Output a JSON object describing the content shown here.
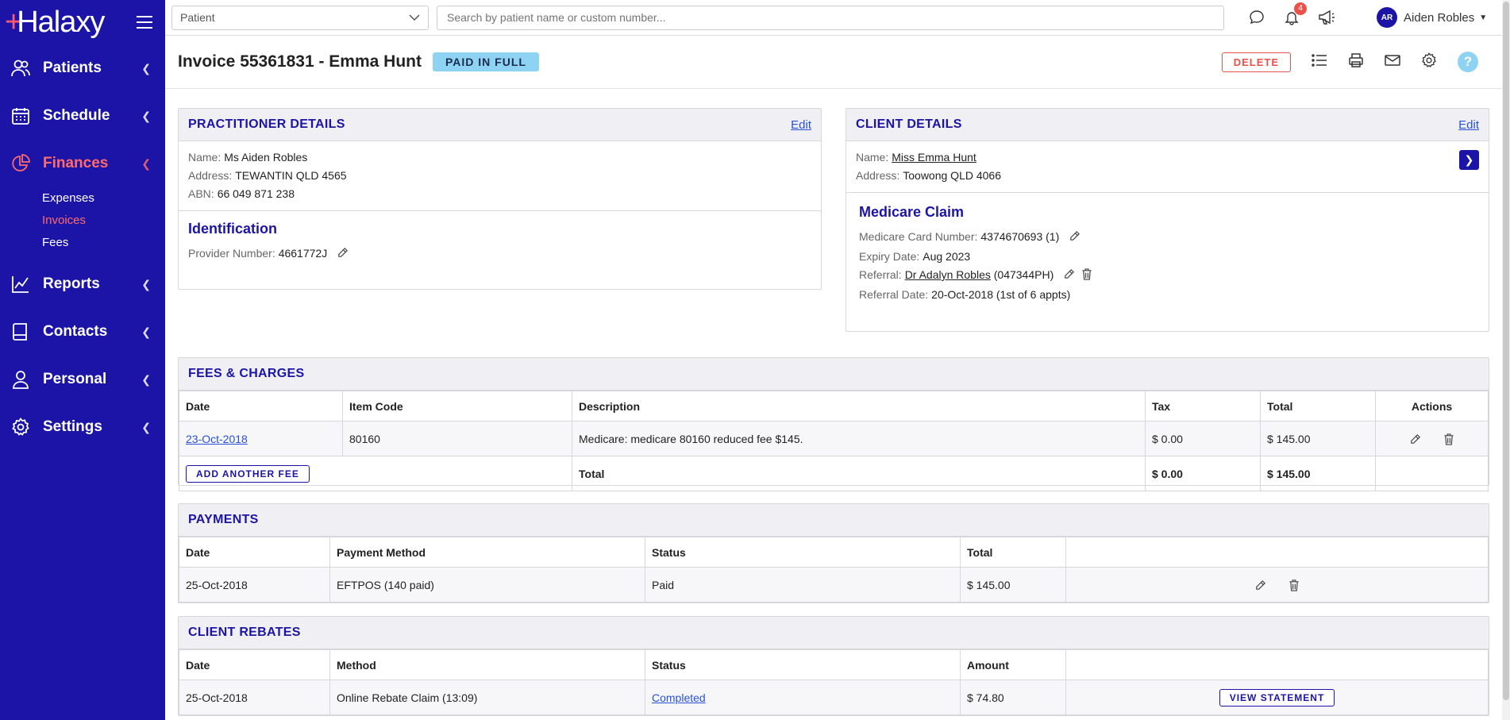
{
  "app": {
    "logo": "Halaxy"
  },
  "sidebar": {
    "items": [
      {
        "label": "Patients"
      },
      {
        "label": "Schedule"
      },
      {
        "label": "Finances"
      },
      {
        "label": "Reports"
      },
      {
        "label": "Contacts"
      },
      {
        "label": "Personal"
      },
      {
        "label": "Settings"
      }
    ],
    "finance_sub": [
      "Expenses",
      "Invoices",
      "Fees"
    ]
  },
  "topbar": {
    "select_value": "Patient",
    "search_placeholder": "Search by patient name or custom number...",
    "notifications_count": "4",
    "user_initials": "AR",
    "user_name": "Aiden Robles"
  },
  "invoice": {
    "title": "Invoice 55361831 - Emma Hunt",
    "status": "PAID IN FULL",
    "delete_label": "DELETE",
    "help": "?"
  },
  "practitioner": {
    "title": "PRACTITIONER DETAILS",
    "edit": "Edit",
    "name_label": "Name:",
    "name": "Ms Aiden Robles",
    "address_label": "Address:",
    "address": "TEWANTIN QLD 4565",
    "abn_label": "ABN:",
    "abn": "66 049 871 238",
    "ident_title": "Identification",
    "provider_label": "Provider Number:",
    "provider": "4661772J"
  },
  "client": {
    "title": "CLIENT DETAILS",
    "edit": "Edit",
    "name_label": "Name:",
    "name": "Miss Emma Hunt",
    "address_label": "Address:",
    "address": "Toowong QLD 4066",
    "medicare_title": "Medicare Claim",
    "card_label": "Medicare Card Number:",
    "card": "4374670693 (1)",
    "expiry_label": "Expiry Date:",
    "expiry": "Aug 2023",
    "referral_label": "Referral:",
    "referral": "Dr Adalyn Robles",
    "referral_code": "(047344PH)",
    "ref_date_label": "Referral Date:",
    "ref_date": "20-Oct-2018 (1st of 6 appts)"
  },
  "fees": {
    "title": "FEES & CHARGES",
    "headers": [
      "Date",
      "Item Code",
      "Description",
      "Tax",
      "Total",
      "Actions"
    ],
    "row": {
      "date": "23-Oct-2018",
      "code": "80160",
      "desc": "Medicare: medicare 80160 reduced fee $145.",
      "tax": "$ 0.00",
      "total": "$ 145.00"
    },
    "add_label": "ADD ANOTHER FEE",
    "total_label": "Total",
    "total_tax": "$ 0.00",
    "total_sum": "$ 145.00"
  },
  "payments": {
    "title": "PAYMENTS",
    "headers": [
      "Date",
      "Payment Method",
      "Status",
      "Total"
    ],
    "row": {
      "date": "25-Oct-2018",
      "method": "EFTPOS (140 paid)",
      "status": "Paid",
      "total": "$ 145.00"
    }
  },
  "rebates": {
    "title": "CLIENT REBATES",
    "headers": [
      "Date",
      "Method",
      "Status",
      "Amount"
    ],
    "row": {
      "date": "25-Oct-2018",
      "method": "Online Rebate Claim (13:09)",
      "status": "Completed",
      "amount": "$ 74.80"
    },
    "view_label": "VIEW STATEMENT"
  }
}
